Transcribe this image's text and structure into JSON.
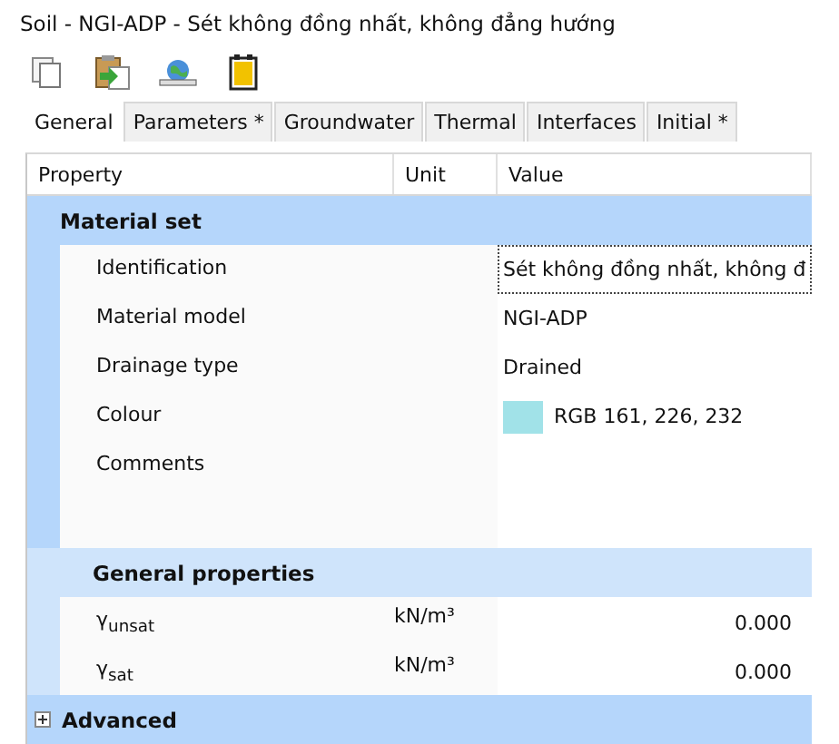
{
  "window": {
    "title": "Soil - NGI-ADP - Sét không đồng nhất, không đẳng hướng"
  },
  "toolbar": [
    {
      "kind": "copy"
    },
    {
      "kind": "paste"
    },
    {
      "kind": "globe"
    },
    {
      "kind": "gauge"
    }
  ],
  "tabs": [
    {
      "label": "General",
      "selected": true
    },
    {
      "label": "Parameters *",
      "selected": false
    },
    {
      "label": "Groundwater",
      "selected": false
    },
    {
      "label": "Thermal",
      "selected": false
    },
    {
      "label": "Interfaces",
      "selected": false
    },
    {
      "label": "Initial *",
      "selected": false
    }
  ],
  "table": {
    "columns": [
      "Property",
      "Unit",
      "Value"
    ],
    "groups": [
      {
        "title": "Material set",
        "kind": "main",
        "expanded": true,
        "rows": [
          {
            "kind": "text",
            "property": "Identification",
            "value": "Sét không đồng nhất, không đ",
            "selected": true
          },
          {
            "kind": "text",
            "property": "Material model",
            "value": "NGI-ADP",
            "selected": false
          },
          {
            "kind": "text",
            "property": "Drainage type",
            "value": "Drained",
            "selected": false
          },
          {
            "kind": "color",
            "property": "Colour",
            "value": "RGB 161, 226, 232",
            "color": "#a1e2e8",
            "selected": false
          },
          {
            "kind": "multiline",
            "property": "Comments",
            "selected": false
          }
        ]
      },
      {
        "title": "General properties",
        "kind": "sub",
        "expanded": true,
        "rows": [
          {
            "kind": "number",
            "property": "γ$_{unsat}$",
            "unit": "kN/m³",
            "value": "0.000",
            "selected": false
          },
          {
            "kind": "number",
            "property": "γ$_{sat}$",
            "unit": "kN/m³",
            "value": "0.000",
            "selected": false
          }
        ]
      },
      {
        "title": "Advanced",
        "kind": "main",
        "expanded": false
      }
    ]
  }
}
